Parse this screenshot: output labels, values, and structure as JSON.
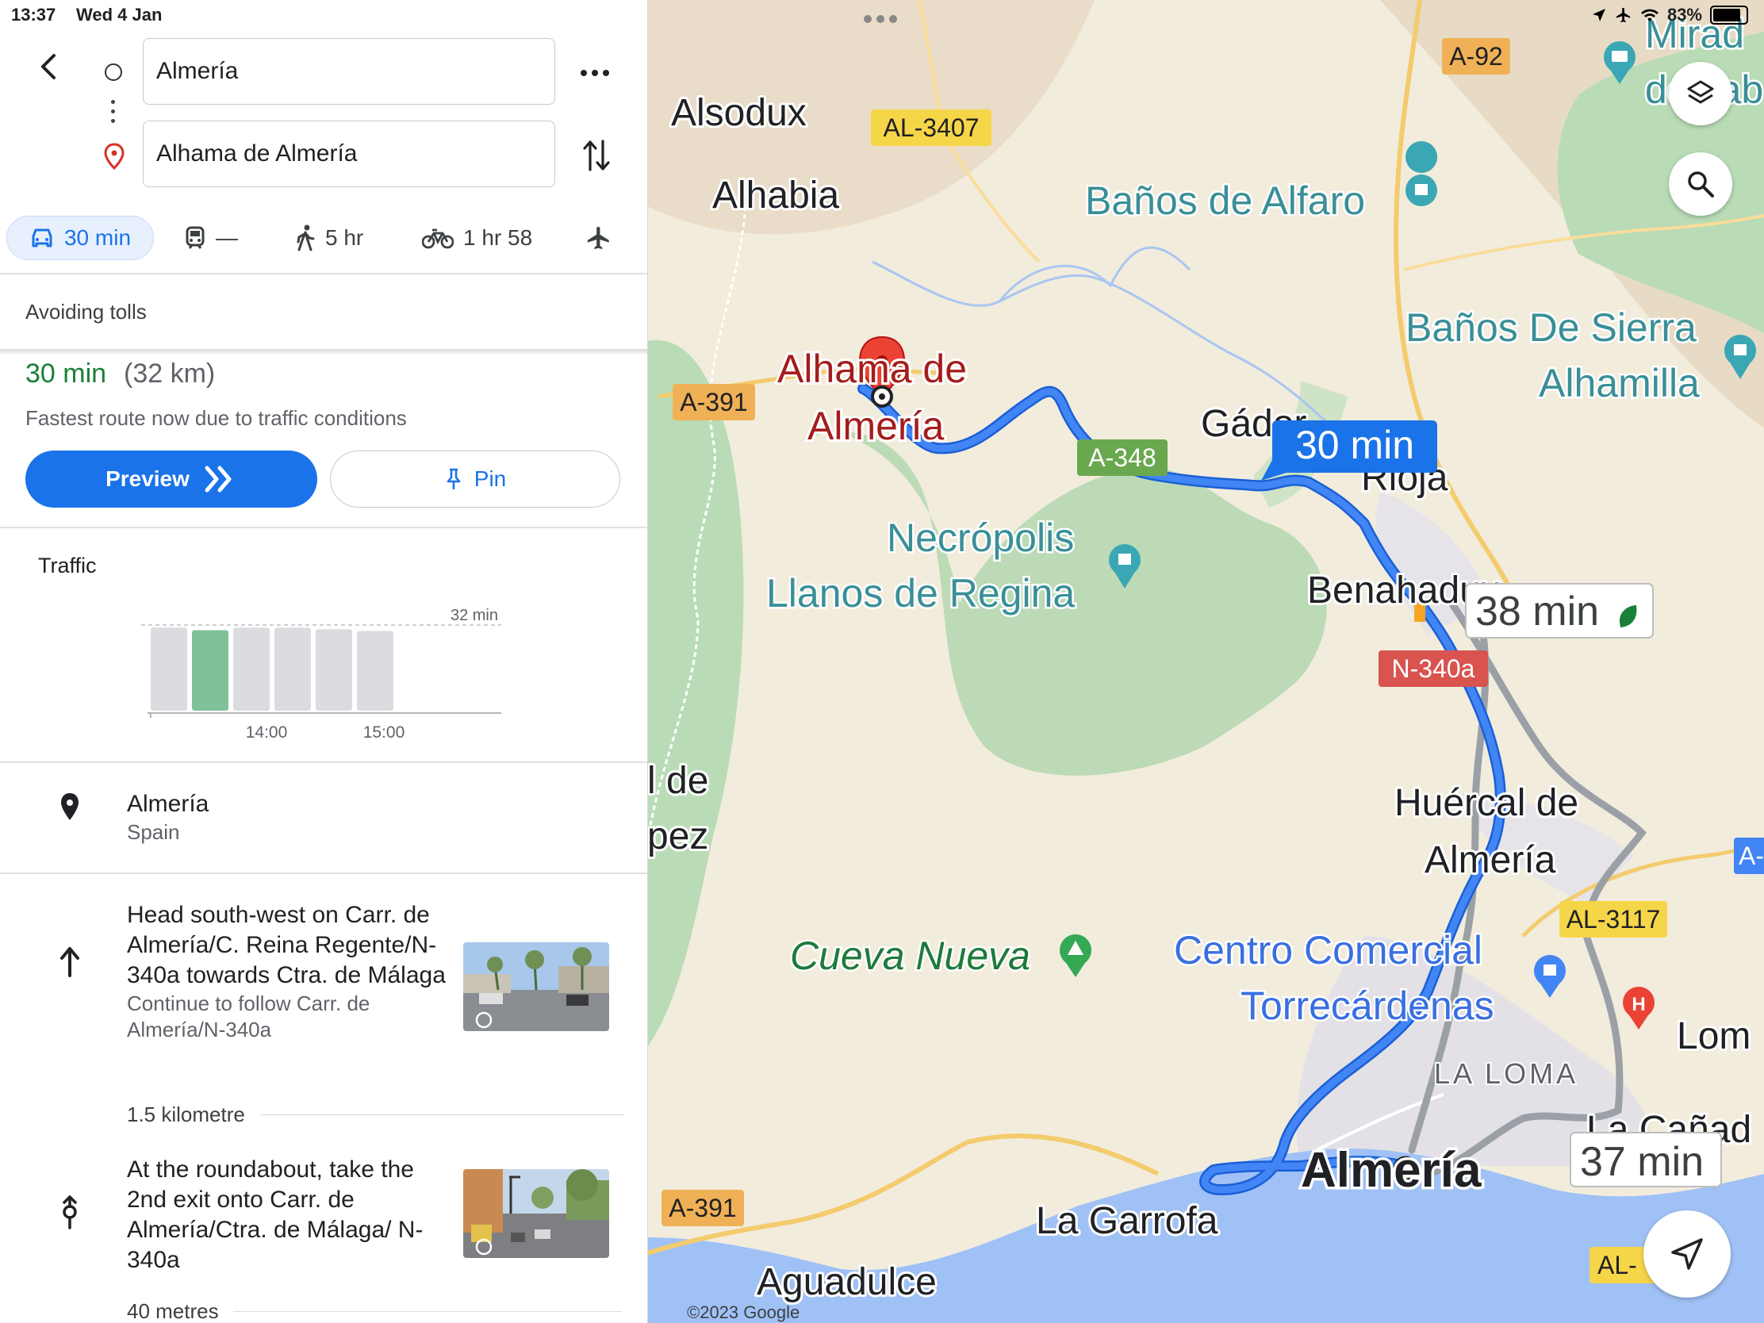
{
  "status_bar": {
    "time": "13:37",
    "date": "Wed 4 Jan",
    "battery": "83%"
  },
  "directions": {
    "origin": "Almería",
    "destination": "Alhama de Almería"
  },
  "modes": {
    "drive": "30 min",
    "transit": "—",
    "walk": "5 hr",
    "cycle": "1 hr 58"
  },
  "route_option": "Avoiding tolls",
  "summary": {
    "time": "30 min",
    "distance": "(32 km)",
    "note": "Fastest route now due to traffic conditions",
    "preview_label": "Preview",
    "pin_label": "Pin"
  },
  "traffic": {
    "title": "Traffic",
    "max_label": "32 min",
    "tick_labels": [
      "14:00",
      "15:00"
    ],
    "bars": [
      0.97,
      0.94,
      0.97,
      0.97,
      0.95,
      0.93
    ],
    "highlight_index": 1
  },
  "start": {
    "name": "Almería",
    "country": "Spain"
  },
  "steps": [
    {
      "instruction": "Head south-west on Carr. de Almería/C. Reina Regente/N-340a towards Ctra. de Málaga",
      "sub": "Continue to follow Carr. de Almería/N-340a",
      "distance": "1.5 kilometre"
    },
    {
      "instruction": "At the roundabout, take the 2nd exit onto Carr. de Almería/Ctra. de Málaga/ N-340a",
      "distance": "40 metres"
    }
  ],
  "map": {
    "places": {
      "alsodux": "Alsodux",
      "alhabia": "Alhabia",
      "banos_alfaro": "Baños de Alfaro",
      "banos_sierra_1": "Baños De Sierra",
      "banos_sierra_2": "Alhamilla",
      "alhama_1": "Alhama de",
      "alhama_2": "Almería",
      "gador": "Gádor",
      "rioja": "Rioja",
      "necropolis_1": "Necrópolis",
      "necropolis_2": "Llanos de Regina",
      "benahadux": "Benahadux",
      "huercal_1": "Huércal de",
      "huercal_2": "Almería",
      "cueva": "Cueva Nueva",
      "centro_1": "Centro Comercial",
      "centro_2": "Torrecárdenas",
      "la_loma": "LA LOMA",
      "almeria": "Almería",
      "la_garrofa": "La Garrofa",
      "aguadulce": "Aguadulce",
      "lde": "l de",
      "pez": "pez",
      "lom": "Lom",
      "canada": "La Cañad",
      "mirador_1": "Mirad",
      "mirador_2": "de Tab"
    },
    "roads": {
      "a92": "A-92",
      "al3407": "AL-3407",
      "a391a": "A-391",
      "a348": "A-348",
      "n340a": "N-340a",
      "al3117": "AL-3117",
      "a391b": "A-391",
      "al_edge": "AL-",
      "a_edge": "A-"
    },
    "route_time_main": "30 min",
    "route_time_alt1": "38 min",
    "route_time_alt2": "37 min",
    "copyright": "©2023 Google",
    "colors": {
      "route": "#4285f4",
      "route_border": "#1a5fd6",
      "alt_route": "#9aa0a6",
      "water": "#9fc1f5",
      "park": "#b9dcb6",
      "land": "#f2ecdd"
    }
  }
}
